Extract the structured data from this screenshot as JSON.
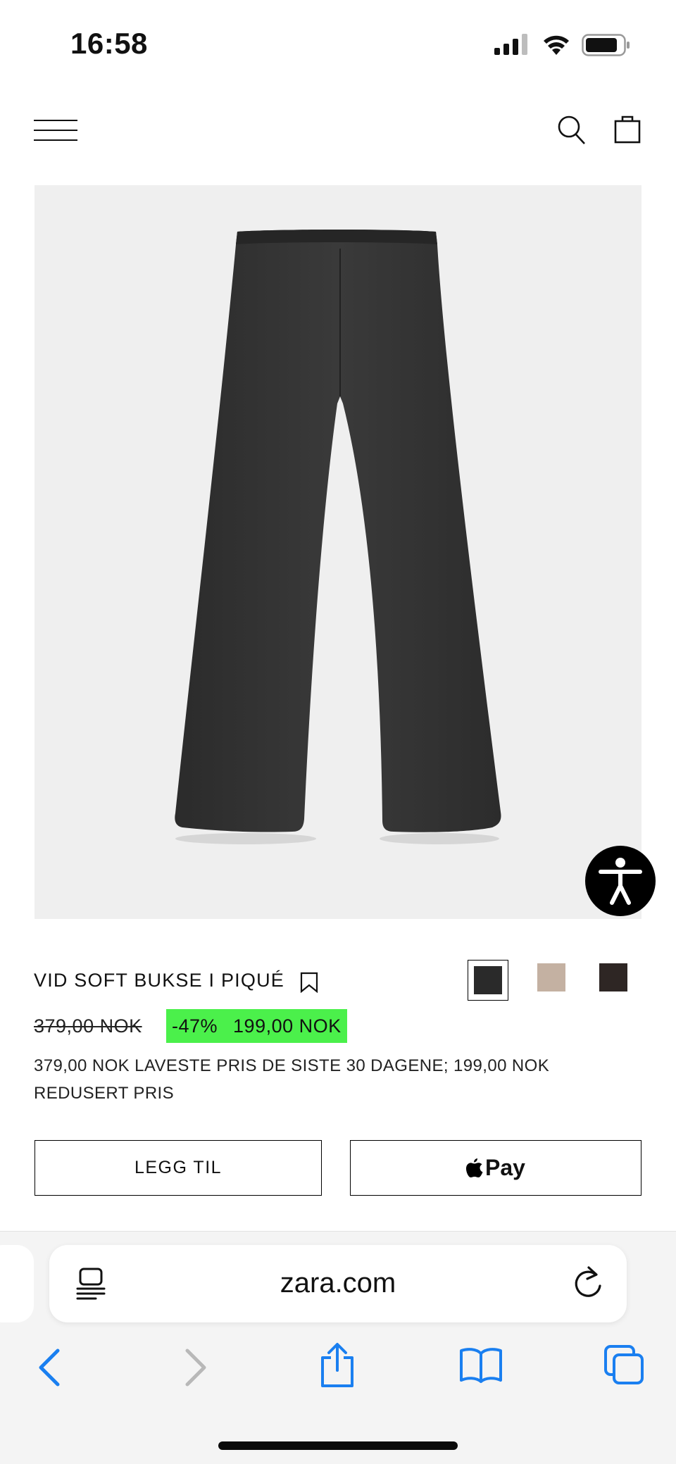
{
  "status_bar": {
    "time": "16:58"
  },
  "product": {
    "title": "VID SOFT BUKSE I PIQUÉ",
    "colors": [
      "#2a2a2a",
      "#c4b1a2",
      "#2e2624"
    ],
    "selected_color_index": 0,
    "price": {
      "original": "379,00 NOK",
      "discount": "-47%",
      "sale": "199,00 NOK",
      "lowest_price_note": "379,00 NOK LAVESTE PRIS DE SISTE 30 DAGENE; 199,00 NOK REDUSERT PRIS"
    },
    "add_label": "LEGG TIL",
    "apple_pay_label": "Pay"
  },
  "browser": {
    "url": "zara.com"
  },
  "colors": {
    "discount_bg": "#4bf04b",
    "ios_blue": "#1a7ff0",
    "image_bg": "#efefef"
  }
}
